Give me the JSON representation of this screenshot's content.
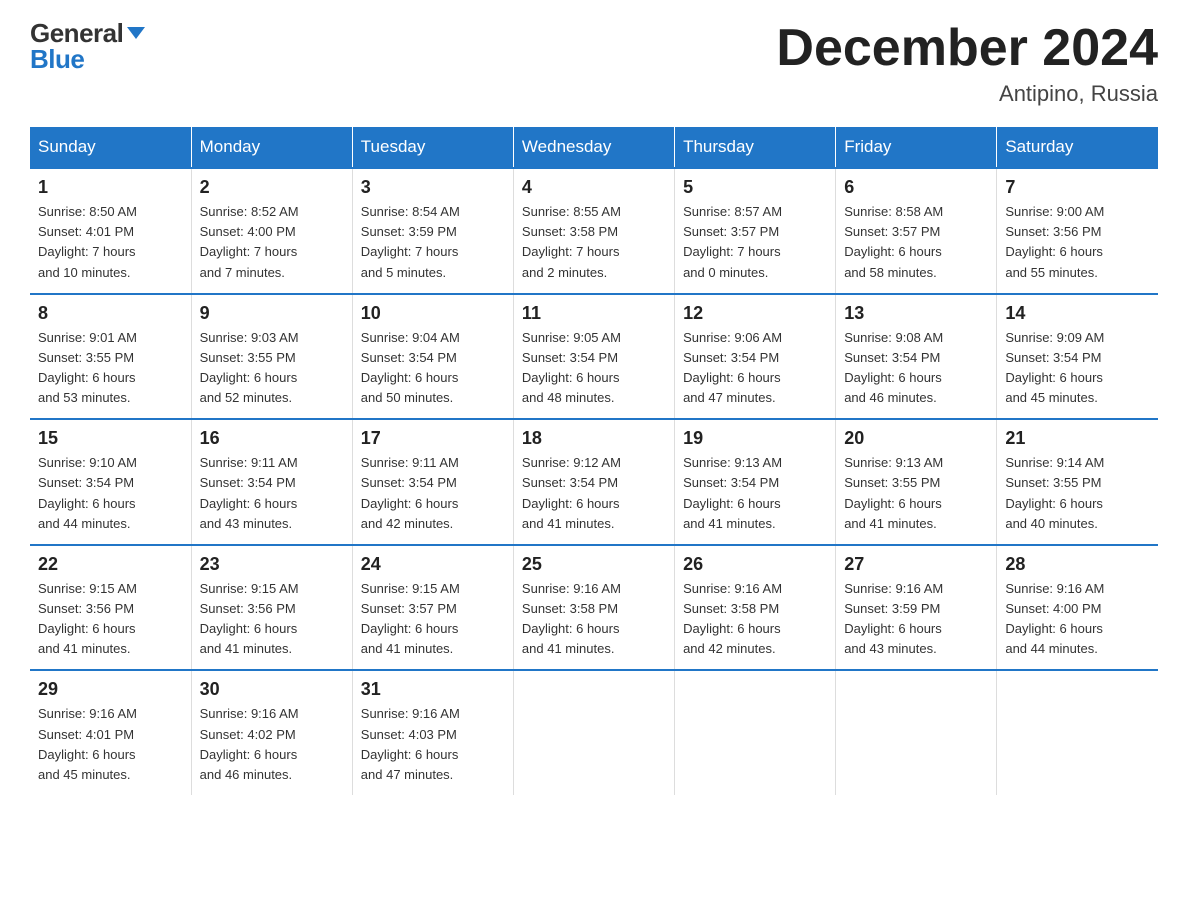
{
  "header": {
    "logo_general": "General",
    "logo_blue": "Blue",
    "month_title": "December 2024",
    "location": "Antipino, Russia"
  },
  "days_of_week": [
    "Sunday",
    "Monday",
    "Tuesday",
    "Wednesday",
    "Thursday",
    "Friday",
    "Saturday"
  ],
  "weeks": [
    [
      {
        "day": "1",
        "info": "Sunrise: 8:50 AM\nSunset: 4:01 PM\nDaylight: 7 hours\nand 10 minutes."
      },
      {
        "day": "2",
        "info": "Sunrise: 8:52 AM\nSunset: 4:00 PM\nDaylight: 7 hours\nand 7 minutes."
      },
      {
        "day": "3",
        "info": "Sunrise: 8:54 AM\nSunset: 3:59 PM\nDaylight: 7 hours\nand 5 minutes."
      },
      {
        "day": "4",
        "info": "Sunrise: 8:55 AM\nSunset: 3:58 PM\nDaylight: 7 hours\nand 2 minutes."
      },
      {
        "day": "5",
        "info": "Sunrise: 8:57 AM\nSunset: 3:57 PM\nDaylight: 7 hours\nand 0 minutes."
      },
      {
        "day": "6",
        "info": "Sunrise: 8:58 AM\nSunset: 3:57 PM\nDaylight: 6 hours\nand 58 minutes."
      },
      {
        "day": "7",
        "info": "Sunrise: 9:00 AM\nSunset: 3:56 PM\nDaylight: 6 hours\nand 55 minutes."
      }
    ],
    [
      {
        "day": "8",
        "info": "Sunrise: 9:01 AM\nSunset: 3:55 PM\nDaylight: 6 hours\nand 53 minutes."
      },
      {
        "day": "9",
        "info": "Sunrise: 9:03 AM\nSunset: 3:55 PM\nDaylight: 6 hours\nand 52 minutes."
      },
      {
        "day": "10",
        "info": "Sunrise: 9:04 AM\nSunset: 3:54 PM\nDaylight: 6 hours\nand 50 minutes."
      },
      {
        "day": "11",
        "info": "Sunrise: 9:05 AM\nSunset: 3:54 PM\nDaylight: 6 hours\nand 48 minutes."
      },
      {
        "day": "12",
        "info": "Sunrise: 9:06 AM\nSunset: 3:54 PM\nDaylight: 6 hours\nand 47 minutes."
      },
      {
        "day": "13",
        "info": "Sunrise: 9:08 AM\nSunset: 3:54 PM\nDaylight: 6 hours\nand 46 minutes."
      },
      {
        "day": "14",
        "info": "Sunrise: 9:09 AM\nSunset: 3:54 PM\nDaylight: 6 hours\nand 45 minutes."
      }
    ],
    [
      {
        "day": "15",
        "info": "Sunrise: 9:10 AM\nSunset: 3:54 PM\nDaylight: 6 hours\nand 44 minutes."
      },
      {
        "day": "16",
        "info": "Sunrise: 9:11 AM\nSunset: 3:54 PM\nDaylight: 6 hours\nand 43 minutes."
      },
      {
        "day": "17",
        "info": "Sunrise: 9:11 AM\nSunset: 3:54 PM\nDaylight: 6 hours\nand 42 minutes."
      },
      {
        "day": "18",
        "info": "Sunrise: 9:12 AM\nSunset: 3:54 PM\nDaylight: 6 hours\nand 41 minutes."
      },
      {
        "day": "19",
        "info": "Sunrise: 9:13 AM\nSunset: 3:54 PM\nDaylight: 6 hours\nand 41 minutes."
      },
      {
        "day": "20",
        "info": "Sunrise: 9:13 AM\nSunset: 3:55 PM\nDaylight: 6 hours\nand 41 minutes."
      },
      {
        "day": "21",
        "info": "Sunrise: 9:14 AM\nSunset: 3:55 PM\nDaylight: 6 hours\nand 40 minutes."
      }
    ],
    [
      {
        "day": "22",
        "info": "Sunrise: 9:15 AM\nSunset: 3:56 PM\nDaylight: 6 hours\nand 41 minutes."
      },
      {
        "day": "23",
        "info": "Sunrise: 9:15 AM\nSunset: 3:56 PM\nDaylight: 6 hours\nand 41 minutes."
      },
      {
        "day": "24",
        "info": "Sunrise: 9:15 AM\nSunset: 3:57 PM\nDaylight: 6 hours\nand 41 minutes."
      },
      {
        "day": "25",
        "info": "Sunrise: 9:16 AM\nSunset: 3:58 PM\nDaylight: 6 hours\nand 41 minutes."
      },
      {
        "day": "26",
        "info": "Sunrise: 9:16 AM\nSunset: 3:58 PM\nDaylight: 6 hours\nand 42 minutes."
      },
      {
        "day": "27",
        "info": "Sunrise: 9:16 AM\nSunset: 3:59 PM\nDaylight: 6 hours\nand 43 minutes."
      },
      {
        "day": "28",
        "info": "Sunrise: 9:16 AM\nSunset: 4:00 PM\nDaylight: 6 hours\nand 44 minutes."
      }
    ],
    [
      {
        "day": "29",
        "info": "Sunrise: 9:16 AM\nSunset: 4:01 PM\nDaylight: 6 hours\nand 45 minutes."
      },
      {
        "day": "30",
        "info": "Sunrise: 9:16 AM\nSunset: 4:02 PM\nDaylight: 6 hours\nand 46 minutes."
      },
      {
        "day": "31",
        "info": "Sunrise: 9:16 AM\nSunset: 4:03 PM\nDaylight: 6 hours\nand 47 minutes."
      },
      {
        "day": "",
        "info": ""
      },
      {
        "day": "",
        "info": ""
      },
      {
        "day": "",
        "info": ""
      },
      {
        "day": "",
        "info": ""
      }
    ]
  ]
}
